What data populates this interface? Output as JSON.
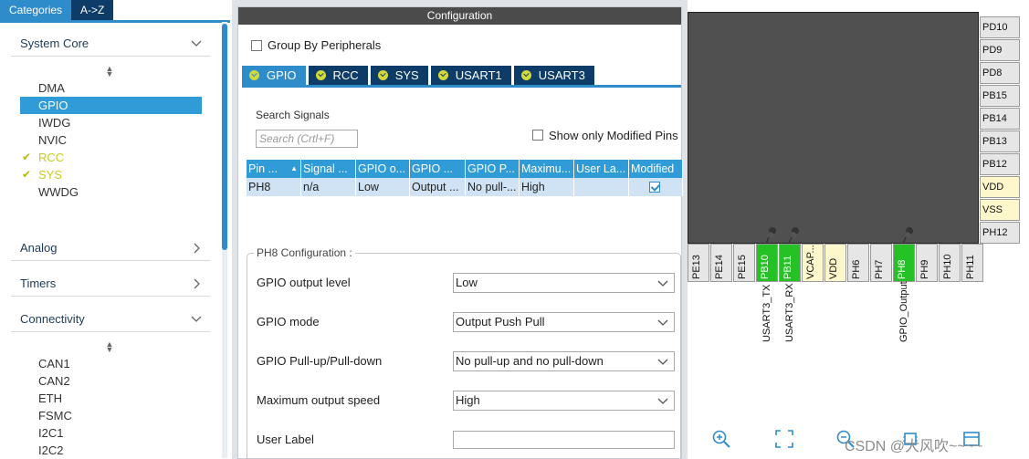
{
  "left": {
    "tabs": [
      {
        "label": "Categories"
      },
      {
        "label": "A->Z"
      }
    ],
    "categories": {
      "system_core": "System Core",
      "analog": "Analog",
      "timers": "Timers",
      "connectivity": "Connectivity"
    },
    "system_core_items": [
      "DMA",
      "GPIO",
      "IWDG",
      "NVIC",
      "RCC",
      "SYS",
      "WWDG"
    ],
    "connectivity_items": [
      "CAN1",
      "CAN2",
      "ETH",
      "FSMC",
      "I2C1",
      "I2C2"
    ]
  },
  "config": {
    "title": "Configuration",
    "group_by": "Group By Peripherals",
    "tabs": [
      "GPIO",
      "RCC",
      "SYS",
      "USART1",
      "USART3"
    ],
    "search_label": "Search Signals",
    "search_placeholder": "Search (Crtl+F)",
    "show_modified": "Show only Modified Pins",
    "table": {
      "headers": [
        "Pin ...",
        "Signal ...",
        "GPIO o...",
        "GPIO ...",
        "GPIO P...",
        "Maximu...",
        "User La...",
        "Modified"
      ],
      "rows": [
        {
          "pin": "PH8",
          "signal": "n/a",
          "level": "Low",
          "mode": "Output ...",
          "pull": "No pull-...",
          "speed": "High",
          "label": "",
          "modified": true
        }
      ]
    },
    "pin_config": {
      "title": "PH8 Configuration :",
      "output_level_label": "GPIO output level",
      "output_level_value": "Low",
      "mode_label": "GPIO mode",
      "mode_value": "Output Push Pull",
      "pull_label": "GPIO Pull-up/Pull-down",
      "pull_value": "No pull-up and no pull-down",
      "speed_label": "Maximum output speed",
      "speed_value": "High",
      "user_label_label": "User Label",
      "user_label_value": ""
    }
  },
  "chip": {
    "right_pins": [
      "PD10",
      "PD9",
      "PD8",
      "PB15",
      "PB14",
      "PB13",
      "PB12",
      "VDD",
      "VSS",
      "PH12"
    ],
    "bottom_pins": [
      "PE13",
      "PE14",
      "PE15",
      "PB10",
      "PB11",
      "VCAP...",
      "VDD",
      "PH6",
      "PH7",
      "PH8",
      "PH9",
      "PH10",
      "PH11"
    ],
    "signal_labels": [
      "USART3_TX",
      "USART3_RX",
      "GPIO_Output"
    ],
    "watermark": "CSDN @大风吹~~~~"
  },
  "colors": {
    "accent": "#2f8ccb",
    "navy": "#0d3c69",
    "pin_green": "#24c224",
    "ok_yellow": "#c7cc1e"
  }
}
